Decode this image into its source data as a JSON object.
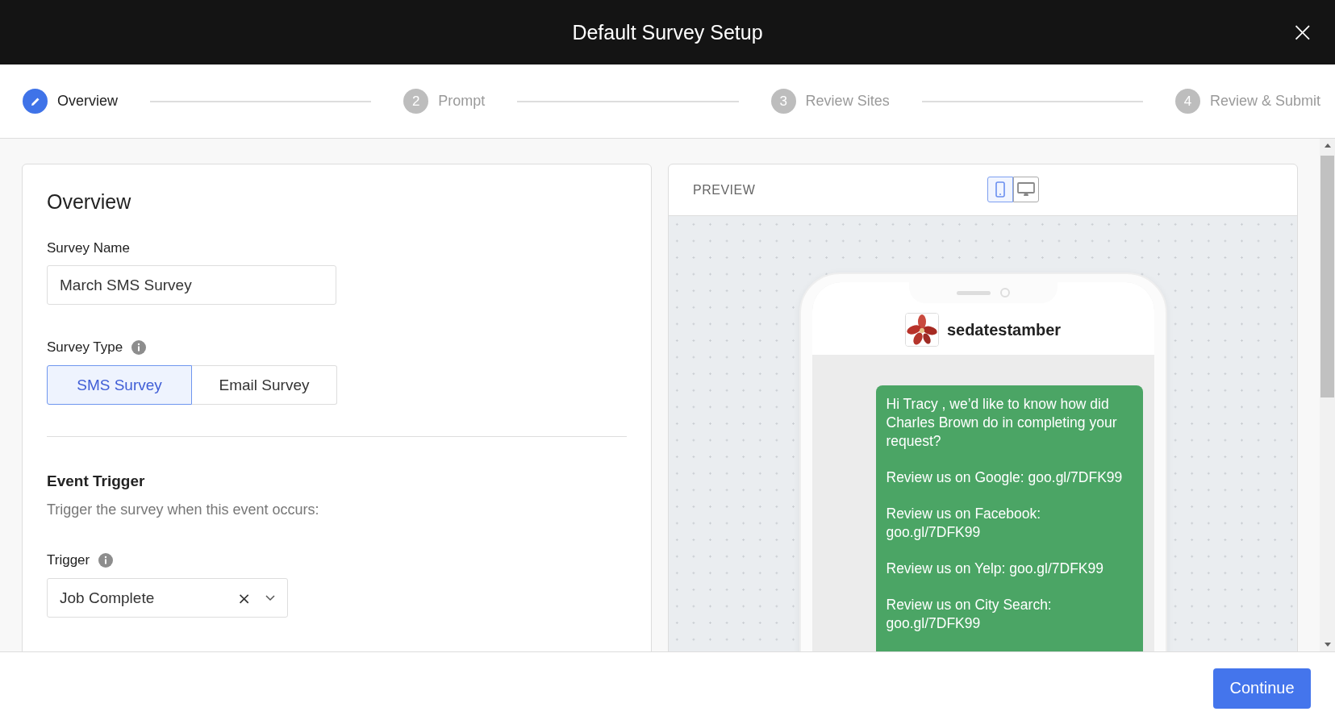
{
  "window": {
    "title": "Default Survey Setup",
    "close": "×"
  },
  "steps": [
    {
      "label": "Overview",
      "selected": true
    },
    {
      "label": "Prompt",
      "number": "2",
      "selected": false
    },
    {
      "label": "Review Sites",
      "number": "3",
      "selected": false
    },
    {
      "label": "Review & Submit",
      "number": "4",
      "selected": false
    }
  ],
  "form": {
    "heading": "Overview",
    "survey_name": {
      "label": "Survey Name",
      "value": "March SMS Survey"
    },
    "survey_type": {
      "label": "Survey Type",
      "options": [
        {
          "label": "SMS Survey",
          "selected": true
        },
        {
          "label": "Email Survey",
          "selected": false
        }
      ]
    },
    "event_trigger": {
      "heading": "Event Trigger",
      "description": "Trigger the survey when this event occurs:"
    },
    "trigger": {
      "label": "Trigger",
      "value": "Job Complete",
      "clear": "×"
    }
  },
  "preview": {
    "label": "PREVIEW",
    "devices": [
      {
        "kind": "phone",
        "selected": true
      },
      {
        "kind": "desktop",
        "selected": false
      }
    ],
    "sender": "sedatestamber",
    "message": [
      "Hi Tracy , we’d like to know how did Charles Brown do in completing your request?",
      "Review us on Google: goo.gl/7DFK99",
      "Review us on Facebook: goo.gl/7DFK99",
      "Review us on Yelp: goo.gl/7DFK99",
      "Review us on City Search: goo.gl/7DFK99"
    ]
  },
  "footer": {
    "continue": "Continue"
  }
}
